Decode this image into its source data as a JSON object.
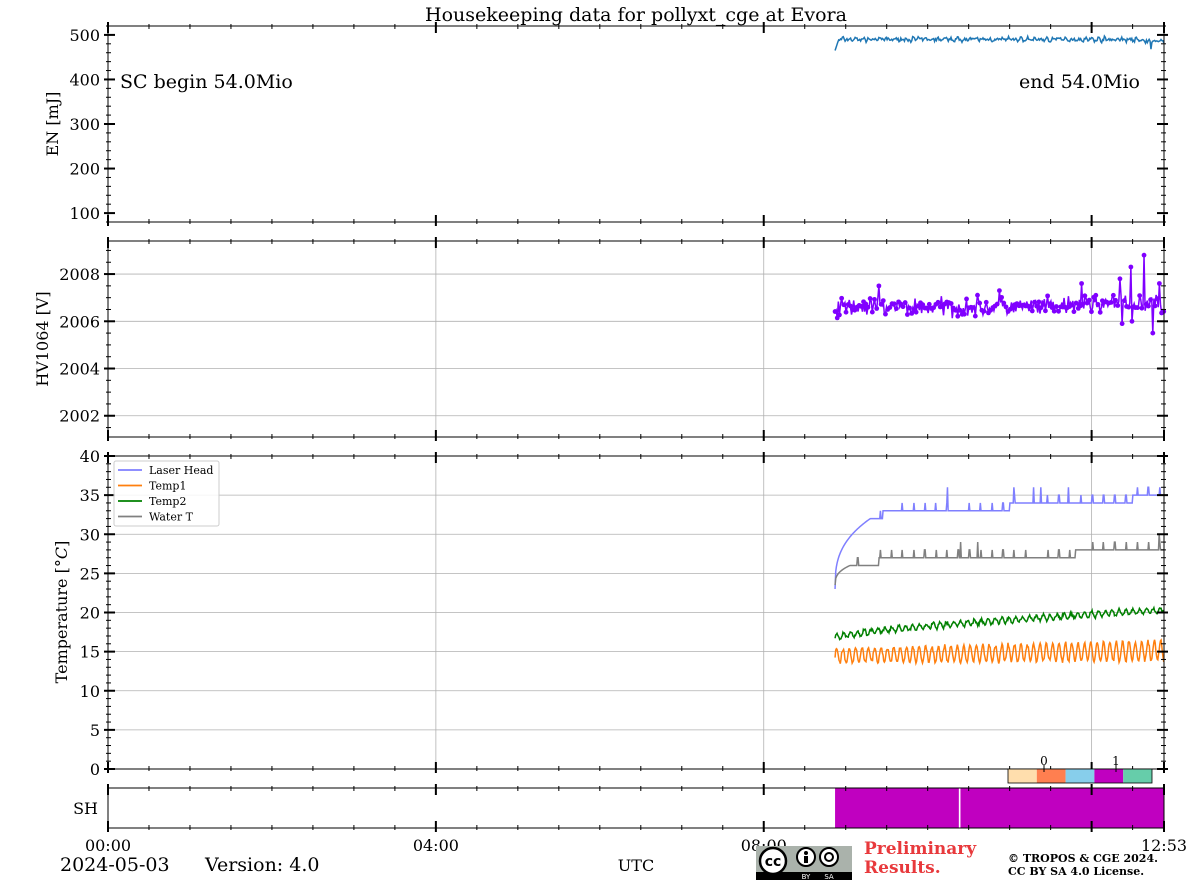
{
  "title": "Housekeeping data for pollyxt_cge at Evora",
  "chart_data": [
    {
      "id": "energy",
      "type": "line",
      "ylabel": "EN [mJ]",
      "ylim": [
        80,
        520
      ],
      "yticks": [
        100,
        200,
        300,
        400,
        500
      ],
      "grid": false,
      "annotations": {
        "left": "SC begin 54.0Mio",
        "right": "end 54.0Mio"
      },
      "series": [
        {
          "color": "#1f77b4",
          "t_start": 8.87,
          "t_end": 12.88,
          "base": 490,
          "noise": 3.5,
          "start_value": 465
        }
      ]
    },
    {
      "id": "hv1064",
      "type": "line",
      "ylabel": "HV1064 [V]",
      "ylim": [
        2001.1,
        2009.4
      ],
      "yticks": [
        2002,
        2004,
        2006,
        2008
      ],
      "grid": true,
      "series": [
        {
          "color": "#8000ff",
          "markers": true,
          "t_start": 8.87,
          "t_end": 12.88,
          "base": 2006.6,
          "noise": 0.3
        }
      ]
    },
    {
      "id": "temperature",
      "type": "line",
      "ylabel": "Temperature [$^\\circ C$]",
      "ylim": [
        0,
        40
      ],
      "yticks": [
        0,
        5,
        10,
        15,
        20,
        25,
        30,
        35,
        40
      ],
      "grid": true,
      "legend": "top-left",
      "series": [
        {
          "name": "Laser Head",
          "color": "#7f7fff",
          "t_start": 8.87,
          "t_end": 12.88,
          "start_value": 23,
          "plateau": [
            [
              9.3,
              32
            ],
            [
              9.45,
              33
            ],
            [
              11.0,
              34
            ],
            [
              12.5,
              35
            ]
          ]
        },
        {
          "name": "Temp1",
          "color": "#ff7f0e",
          "t_start": 8.87,
          "t_end": 12.88,
          "base": 14.5,
          "oscillation": 1.2
        },
        {
          "name": "Temp2",
          "color": "#008000",
          "t_start": 8.87,
          "t_end": 12.88,
          "start_value": 16.8,
          "end_value": 20.3
        },
        {
          "name": "Water T",
          "color": "#808080",
          "t_start": 8.87,
          "t_end": 12.88,
          "start_value": 23.5,
          "plateau": [
            [
              9.05,
              26
            ],
            [
              9.4,
              27
            ],
            [
              11.8,
              28
            ]
          ]
        }
      ]
    },
    {
      "id": "shutter",
      "type": "heatmap",
      "ylabel": "SH",
      "segments": [
        {
          "t_start": 8.87,
          "t_end": 10.38,
          "value": 1
        },
        {
          "t_start": 10.4,
          "t_end": 12.88,
          "value": 1
        }
      ],
      "colorbar": {
        "ticks": [
          "0",
          "1"
        ],
        "colors": [
          "#ffdead",
          "#ff7f50",
          "#87ceeb",
          "#c000c0",
          "#66cdaa"
        ]
      }
    }
  ],
  "x_axis": {
    "range_hours": [
      0,
      12.883
    ],
    "ticks": [
      {
        "t": 0,
        "label": "00:00"
      },
      {
        "t": 4,
        "label": "04:00"
      },
      {
        "t": 8,
        "label": "08:00"
      },
      {
        "t": 12,
        "label": ""
      },
      {
        "t": 12.883,
        "label": "12:53"
      }
    ],
    "label": "UTC"
  },
  "footer": {
    "date": "2024-05-03",
    "version": "Version: 4.0",
    "preliminary_line1": "Preliminary",
    "preliminary_line2": "Results.",
    "copyright_line1": "© TROPOS & CGE 2024.",
    "copyright_line2": "CC BY SA 4.0 License.",
    "license_badge": {
      "main": "cc",
      "left": "BY",
      "right": "SA"
    }
  }
}
